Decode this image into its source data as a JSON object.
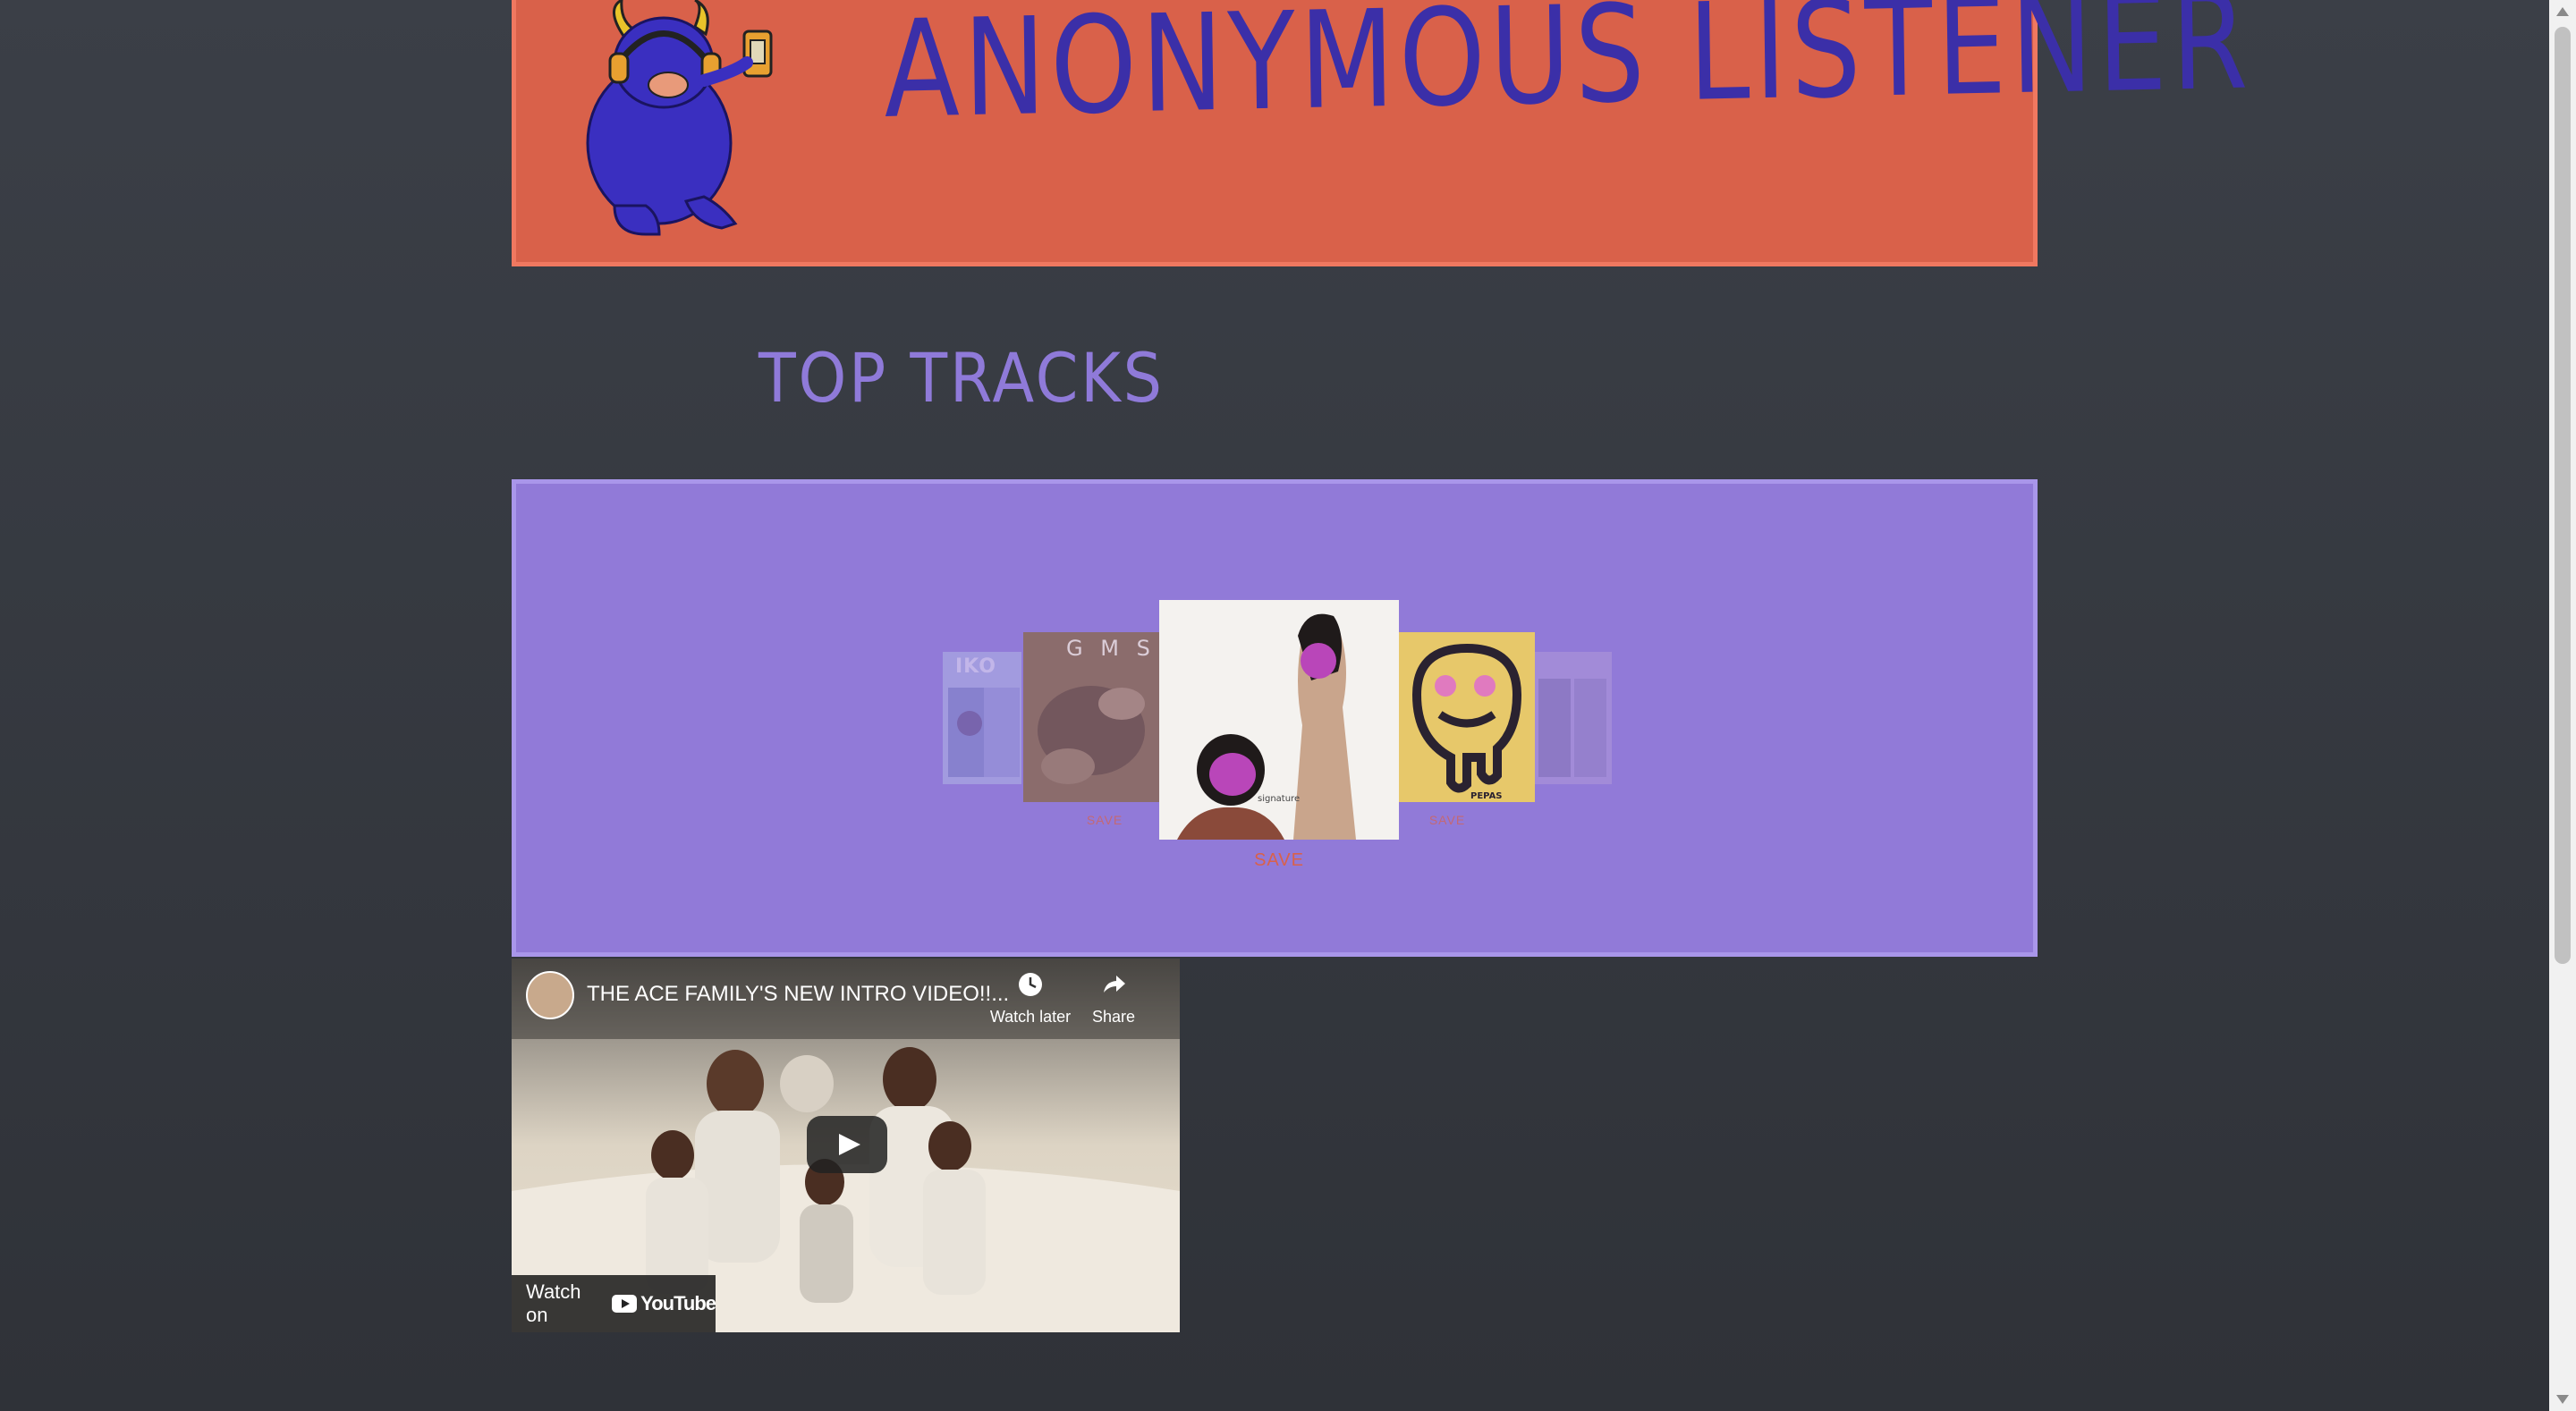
{
  "header": {
    "title": "ANONYMOUS LISTENER",
    "mascot": "bison-with-headphones-logo"
  },
  "section": {
    "title": "TOP TRACKS"
  },
  "carousel": {
    "albums": [
      {
        "name": "album-cover-1",
        "text": "IKO"
      },
      {
        "name": "album-cover-2",
        "text": "G M S",
        "save_label": "SAVE"
      },
      {
        "name": "album-cover-center",
        "save_label": "SAVE"
      },
      {
        "name": "album-cover-smiley",
        "text": "PEPAS",
        "save_label": "SAVE"
      },
      {
        "name": "album-cover-5"
      }
    ]
  },
  "video": {
    "title": "THE ACE FAMILY'S NEW INTRO VIDEO!!...",
    "watch_later": "Watch later",
    "share": "Share",
    "watch_on": "Watch on",
    "youtube": "YouTube"
  },
  "colors": {
    "header_bg": "#d9614a",
    "title_color": "#3b2fa8",
    "section_title": "#8f7ad9",
    "carousel_bg": "#917ad8",
    "save_color": "#d9614a"
  }
}
